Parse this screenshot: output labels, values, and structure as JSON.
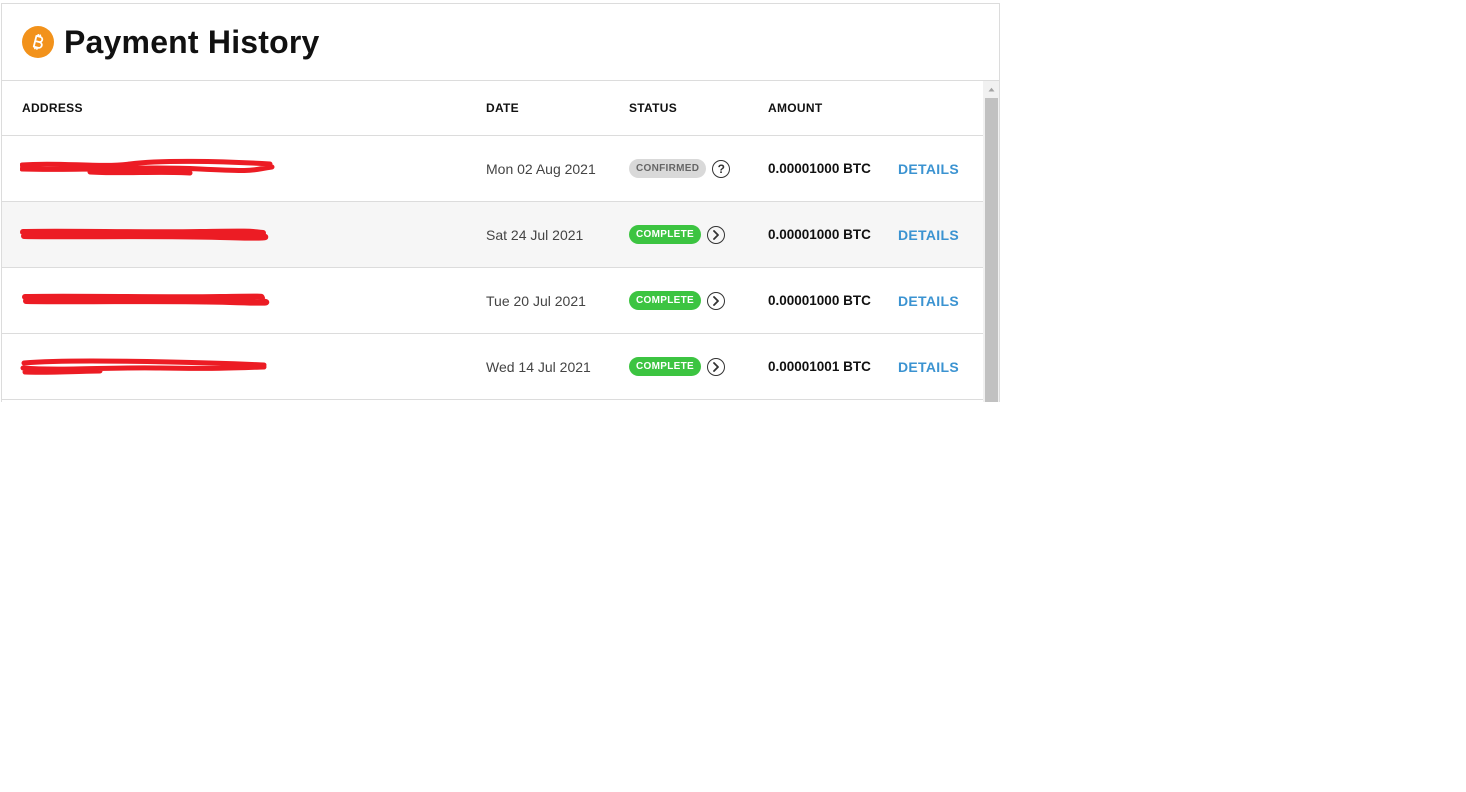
{
  "page": {
    "title": "Payment History"
  },
  "table": {
    "headers": {
      "address": "ADDRESS",
      "date": "DATE",
      "status": "STATUS",
      "amount": "AMOUNT"
    },
    "rows": [
      {
        "date": "Mon 02 Aug 2021",
        "status": "CONFIRMED",
        "status_kind": "confirmed",
        "status_icon": "help-icon",
        "amount": "0.00001000 BTC",
        "action": "DETAILS"
      },
      {
        "date": "Sat 24 Jul 2021",
        "status": "COMPLETE",
        "status_kind": "complete",
        "status_icon": "chevron-right-circle-icon",
        "amount": "0.00001000 BTC",
        "action": "DETAILS"
      },
      {
        "date": "Tue 20 Jul 2021",
        "status": "COMPLETE",
        "status_kind": "complete",
        "status_icon": "chevron-right-circle-icon",
        "amount": "0.00001000 BTC",
        "action": "DETAILS"
      },
      {
        "date": "Wed 14 Jul 2021",
        "status": "COMPLETE",
        "status_kind": "complete",
        "status_icon": "chevron-right-circle-icon",
        "amount": "0.00001001 BTC",
        "action": "DETAILS"
      }
    ]
  },
  "colors": {
    "bitcoin_orange": "#f2921b",
    "complete_green": "#3cc441",
    "confirmed_gray": "#d9d9d9",
    "link_blue": "#3b93d1",
    "redaction_red": "#ec1c24"
  },
  "icons": {
    "logo": "bitcoin-logo-icon"
  }
}
